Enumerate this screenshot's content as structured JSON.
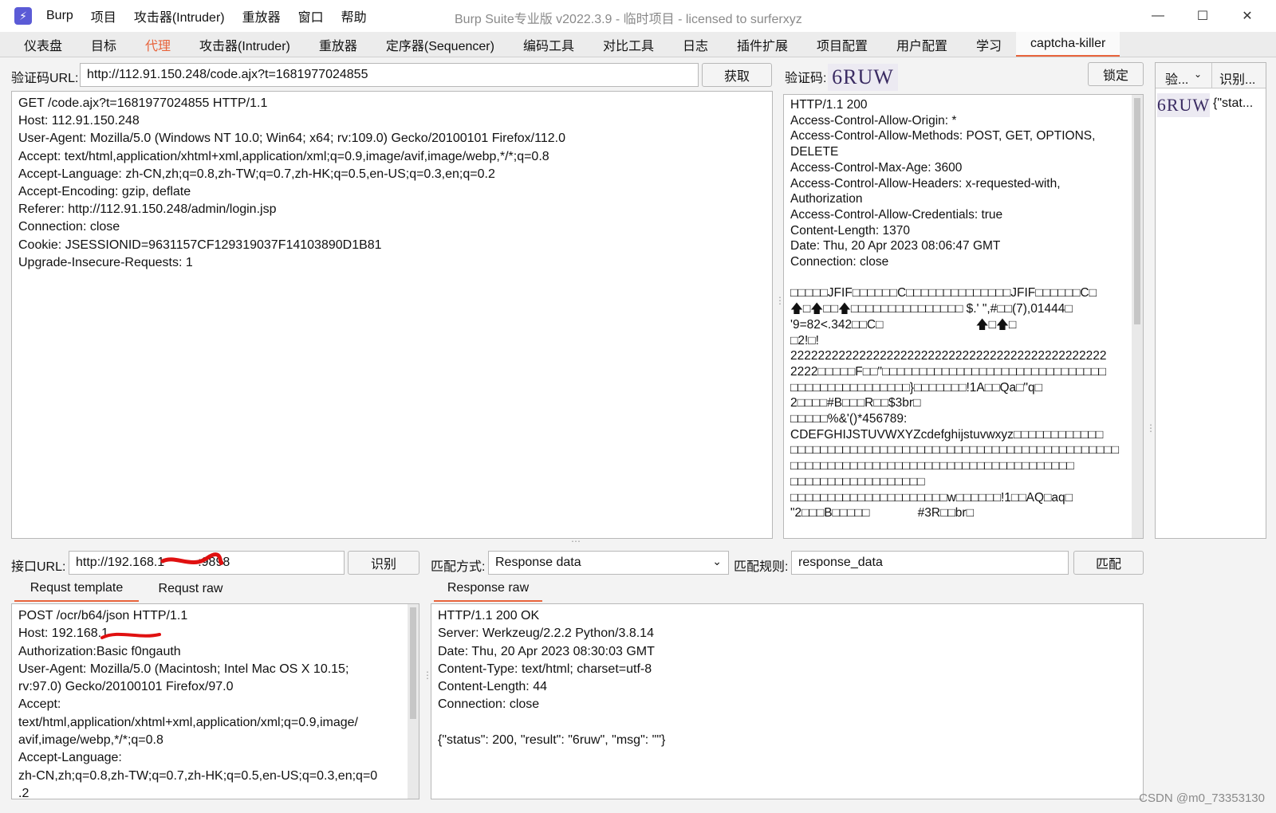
{
  "window": {
    "title": "Burp Suite专业版  v2022.3.9 - 临时项目 - licensed to surferxyz",
    "app_icon": "burp-lightning-icon"
  },
  "menu": [
    "Burp",
    "项目",
    "攻击器(Intruder)",
    "重放器",
    "窗口",
    "帮助"
  ],
  "tabs": [
    {
      "label": "仪表盘"
    },
    {
      "label": "目标"
    },
    {
      "label": "代理"
    },
    {
      "label": "攻击器(Intruder)"
    },
    {
      "label": "重放器"
    },
    {
      "label": "定序器(Sequencer)"
    },
    {
      "label": "编码工具"
    },
    {
      "label": "对比工具"
    },
    {
      "label": "日志"
    },
    {
      "label": "插件扩展"
    },
    {
      "label": "项目配置"
    },
    {
      "label": "用户配置"
    },
    {
      "label": "学习"
    },
    {
      "label": "captcha-killer"
    }
  ],
  "captcha_url": {
    "label": "验证码URL:",
    "value": "http://112.91.150.248/code.ajx?t=1681977024855",
    "fetch_button": "获取"
  },
  "request_lines": [
    "GET /code.ajx?t=1681977024855 HTTP/1.1",
    "Host: 112.91.150.248",
    "User-Agent: Mozilla/5.0 (Windows NT 10.0; Win64; x64; rv:109.0) Gecko/20100101 Firefox/112.0",
    "Accept: text/html,application/xhtml+xml,application/xml;q=0.9,image/avif,image/webp,*/*;q=0.8",
    "Accept-Language: zh-CN,zh;q=0.8,zh-TW;q=0.7,zh-HK;q=0.5,en-US;q=0.3,en;q=0.2",
    "Accept-Encoding: gzip, deflate",
    "Referer: http://112.91.150.248/admin/login.jsp",
    "Connection: close",
    "Cookie: JSESSIONID=9631157CF129319037F14103890D1B81",
    "Upgrade-Insecure-Requests: 1"
  ],
  "captcha": {
    "label": "验证码:",
    "image_text": "6RUW",
    "lock_button": "锁定"
  },
  "captcha_response_lines": [
    "HTTP/1.1 200",
    "Access-Control-Allow-Origin: *",
    "Access-Control-Allow-Methods: POST, GET, OPTIONS,",
    "DELETE",
    "Access-Control-Max-Age: 3600",
    "Access-Control-Allow-Headers: x-requested-with,",
    "Authorization",
    "Access-Control-Allow-Credentials: true",
    "Content-Length: 1370",
    "Date: Thu, 20 Apr 2023 08:06:47 GMT",
    "Connection: close",
    "",
    "□□□□□JFIF□□□□□□C□□□□□□□□□□□□□□JFIF□□□□□□C□",
    "🡅□🡅□□🡅□□□□□□□□□□□□□□□ $.' \",#□□(7),01444□",
    "'9=82<.342□□C□                           🡅□🡅□",
    "□2!□!",
    "2222222222222222222222222222222222222222222222",
    "2222□□□□□F□□\"□□□□□□□□□□□□□□□□□□□□□□□□□□□□□□",
    "□□□□□□□□□□□□□□□□}□□□□□□□!1A□□Qa□\"q□",
    "2□□□□#B□□□R□□$3br□",
    "□□□□□%&'()*456789:",
    "CDEFGHIJSTUVWXYZcdefghijstuvwxyz□□□□□□□□□□□□",
    "□□□□□□□□□□□□□□□□□□□□□□□□□□□□□□□□□□□□□□□□□□□□",
    "□□□□□□□□□□□□□□□□□□□□□□□□□□□□□□□□□□□□□□",
    "□□□□□□□□□□□□□□□□□□",
    "□□□□□□□□□□□□□□□□□□□□□w□□□□□□!1□□AQ□aq□",
    "\"2□□□B□□□□□              #3R□□br□"
  ],
  "history": {
    "col_captcha": "验...",
    "col_result": "识别...",
    "row_image": "6RUW",
    "row_result": "{\"stat..."
  },
  "api_url": {
    "label": "接口URL:",
    "value": "http://192.168.1",
    "value_tail": ":9898",
    "recognize_button": "识别"
  },
  "match": {
    "mode_label": "匹配方式:",
    "mode_value": "Response data",
    "rule_label": "匹配规则:",
    "rule_value": "response_data",
    "match_button": "匹配"
  },
  "template_tabs": [
    "Requst template",
    "Requst raw"
  ],
  "template_lines": [
    "POST /ocr/b64/json HTTP/1.1",
    "Host: 192.168.1",
    "Authorization:Basic f0ngauth",
    "User-Agent: Mozilla/5.0 (Macintosh; Intel Mac OS X 10.15;",
    "rv:97.0) Gecko/20100101 Firefox/97.0",
    "Accept:",
    "text/html,application/xhtml+xml,application/xml;q=0.9,image/",
    "avif,image/webp,*/*;q=0.8",
    "Accept-Language:",
    "zh-CN,zh;q=0.8,zh-TW;q=0.7,zh-HK;q=0.5,en-US;q=0.3,en;q=0",
    ".2"
  ],
  "response_tab": "Response raw",
  "response_lines": [
    "HTTP/1.1 200 OK",
    "Server: Werkzeug/2.2.2 Python/3.8.14",
    "Date: Thu, 20 Apr 2023 08:30:03 GMT",
    "Content-Type: text/html; charset=utf-8",
    "Content-Length: 44",
    "Connection: close",
    "",
    "{\"status\": 200, \"result\": \"6ruw\", \"msg\": \"\"}"
  ],
  "watermark": "CSDN @m0_73353130"
}
